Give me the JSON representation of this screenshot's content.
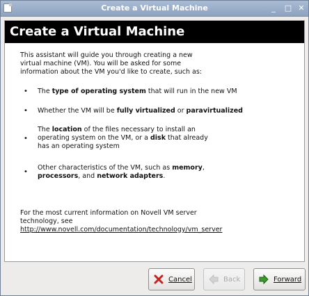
{
  "window": {
    "title": "Create a Virtual Machine",
    "controls": {
      "minimize": "_",
      "maximize": "□",
      "close": "✕"
    }
  },
  "header": {
    "title": "Create a Virtual Machine"
  },
  "intro": "This assistant will guide you through creating a new virtual machine (VM).  You will be asked for some information about the VM you'd like to create, such as:",
  "bullets": [
    {
      "a": "The ",
      "b": "type of operating system",
      "c": " that will run in the new VM"
    },
    {
      "a": "Whether the VM will be ",
      "b": "fully virtualized",
      "c": " or ",
      "d": "paravirtualized"
    },
    {
      "a": "The ",
      "b": "location",
      "c": " of the files necessary to install an operating system on the VM, or a ",
      "d": "disk",
      "e": " that already has an operating system"
    },
    {
      "a": "Other characteristics of the VM, such as ",
      "b": "memory",
      "c": ", ",
      "d": "processors",
      "e": ", and ",
      "f": "network adapters",
      "g": "."
    }
  ],
  "footer": {
    "text": "For the most current information on Novell VM server technology, see ",
    "link": "http://www.novell.com/documentation/technology/vm_server"
  },
  "buttons": {
    "cancel": "Cancel",
    "back": "Back",
    "forward": "Forward"
  },
  "icons": {
    "cancel": "red-x-icon",
    "back": "back-arrow-icon",
    "forward": "green-forward-arrow-icon"
  },
  "colors": {
    "titlebar": "#9cb0cc",
    "header": "#000000",
    "forward_arrow": "#3a9a2a",
    "cancel_x": "#c62020"
  }
}
